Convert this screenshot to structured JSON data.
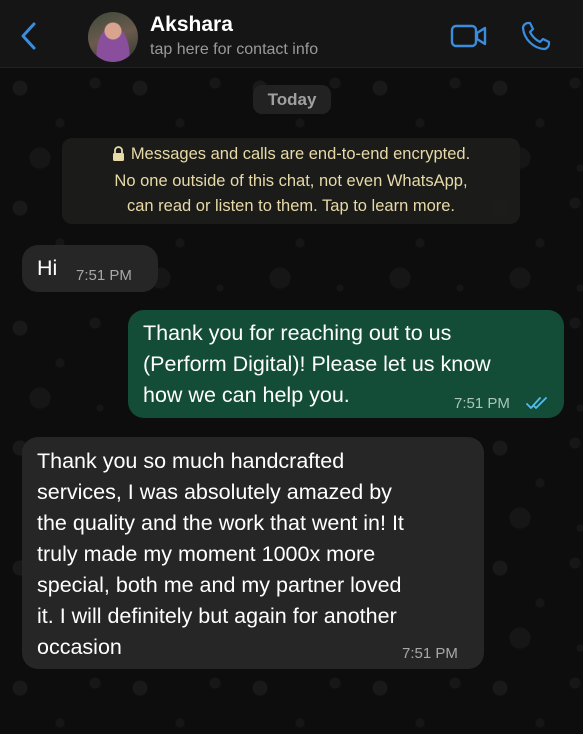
{
  "header": {
    "contact_name": "Akshara",
    "contact_subtitle": "tap here for contact info",
    "back_icon": "chevron-left-icon",
    "video_icon": "video-camera-icon",
    "call_icon": "phone-icon",
    "accent_color": "#3a8dde"
  },
  "chat": {
    "date_label": "Today",
    "encryption_notice": {
      "line1": "Messages and calls are end-to-end encrypted.",
      "line2": "No one outside of this chat, not even WhatsApp,",
      "line3": "can read or listen to them. Tap to learn more.",
      "icon": "lock-icon"
    },
    "messages": [
      {
        "direction": "incoming",
        "lines": [
          "Hi"
        ],
        "time": "7:51 PM"
      },
      {
        "direction": "outgoing",
        "lines": [
          "Thank you for reaching out to us",
          "(Perform Digital)! Please let us know",
          "how we can help you."
        ],
        "time": "7:51 PM",
        "status": "read"
      },
      {
        "direction": "incoming",
        "lines": [
          "Thank you so much handcrafted",
          "services, I was absolutely amazed by",
          "the quality and the work that went in! It",
          "truly made my moment 1000x more",
          "special, both me and my partner loved",
          "it. I will definitely but again for another",
          "occasion"
        ],
        "time": "7:51 PM"
      }
    ]
  },
  "colors": {
    "incoming_bubble": "#262626",
    "outgoing_bubble": "#144d37",
    "read_ticks": "#53bdeb",
    "encryption_text": "#e7d9a8"
  }
}
